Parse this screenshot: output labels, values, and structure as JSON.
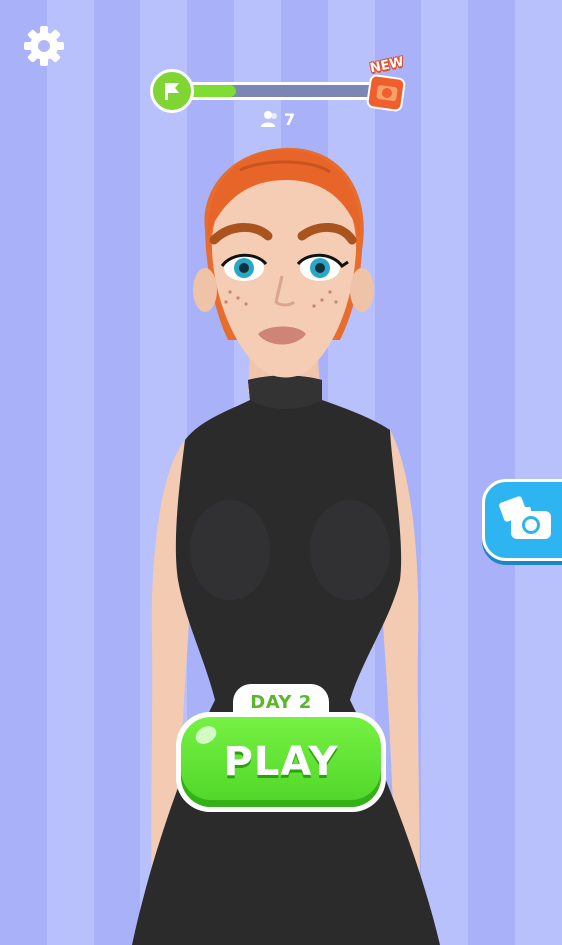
{
  "colors": {
    "stripe_a": "#a9b2f8",
    "stripe_b": "#b8c1fb",
    "accent_green": "#7ed534",
    "camera_blue": "#2eb4f1",
    "reward_orange": "#ee5f2d"
  },
  "top": {
    "settings_icon": "gear-icon",
    "progress": {
      "level_fraction": 0.3,
      "start_icon": "flag-icon",
      "reward_icon": "camera-reward-icon",
      "reward_badge": "NEW"
    },
    "players": {
      "icon": "user-icon",
      "count": "7"
    }
  },
  "side": {
    "camera_button_icon": "camera-photos-icon"
  },
  "play": {
    "day_label": "DAY 2",
    "play_label": "PLAY"
  }
}
